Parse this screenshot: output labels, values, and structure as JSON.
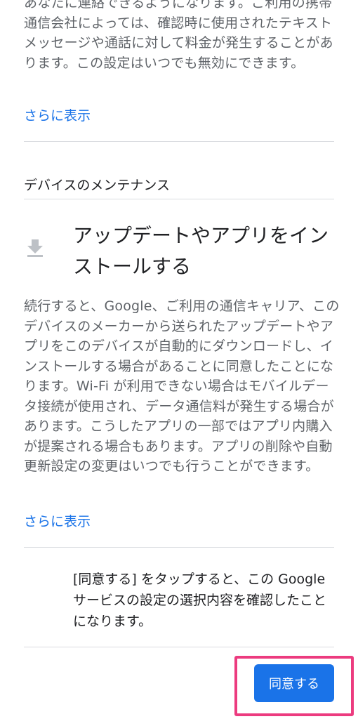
{
  "top_section": {
    "text": "あなたに連絡できるようになります。ご利用の携帯通信会社によっては、確認時に使用されたテキスト メッセージや通話に対して料金が発生することがあります。この設定はいつでも無効にできます。",
    "show_more": "さらに表示"
  },
  "device_maintenance": {
    "section_title": "デバイスのメンテナンス",
    "item_title": "アップデートやアプリをインストールする",
    "icon": "download-icon",
    "body": "続行すると、Google、ご利用の通信キャリア、このデバイスのメーカーから送られたアップデートやアプリをこのデバイスが自動的にダウンロードし、インストールする場合があることに同意したことになります。Wi-Fi が利用できない場合はモバイルデータ接続が使用され、データ通信料が発生する場合があります。こうしたアプリの一部ではアプリ内購入が提案される場合もあります。アプリの削除や自動更新設定の変更はいつでも行うことができます。",
    "show_more": "さらに表示"
  },
  "consent": {
    "text": "[同意する] をタップすると、この Google サービスの設定の選択内容を確認したことになります。"
  },
  "actions": {
    "agree_label": "同意する"
  },
  "colors": {
    "link": "#1a73e8",
    "button": "#1a73e8",
    "highlight": "#ec3b7f"
  }
}
